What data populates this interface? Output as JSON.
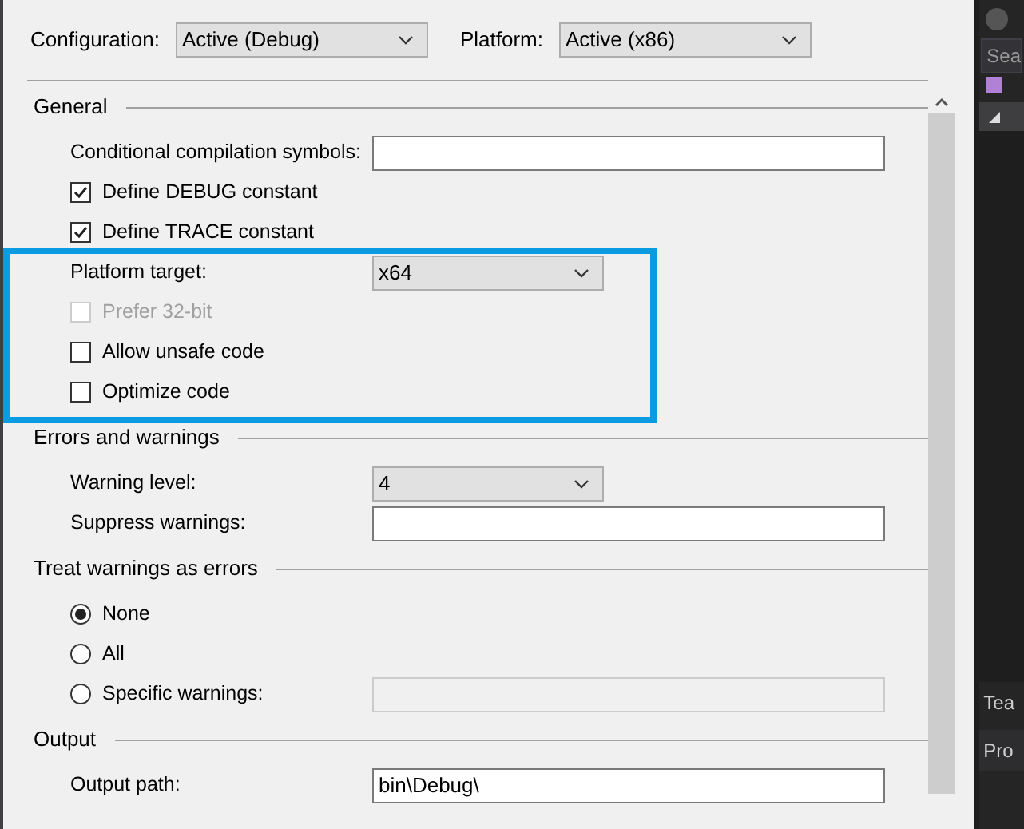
{
  "toolbar": [
    {
      "label": "Configuration:",
      "value": "Active (Debug)"
    },
    {
      "label": "Platform:",
      "value": "Active (x86)"
    }
  ],
  "sections": [
    {
      "title": "General",
      "rows": [
        {
          "kind": "text",
          "label": "Conditional compilation symbols:"
        },
        {
          "kind": "checkbox",
          "label": "Define DEBUG constant",
          "checked": true,
          "disabled": false
        },
        {
          "kind": "checkbox",
          "label": "Define TRACE constant",
          "checked": true,
          "disabled": false
        },
        {
          "kind": "dropdown",
          "label": "Platform target:",
          "value": "x64"
        },
        {
          "kind": "checkbox",
          "label": "Prefer 32-bit",
          "checked": false,
          "disabled": true
        },
        {
          "kind": "checkbox",
          "label": "Allow unsafe code",
          "checked": false,
          "disabled": false
        },
        {
          "kind": "checkbox",
          "label": "Optimize code",
          "checked": false,
          "disabled": false
        }
      ]
    },
    {
      "title": "Errors and warnings",
      "rows": [
        {
          "kind": "dropdown",
          "label": "Warning level:",
          "value": "4"
        },
        {
          "kind": "text",
          "label": "Suppress warnings:"
        }
      ]
    },
    {
      "title": "Treat warnings as errors",
      "rows": [
        {
          "kind": "radio",
          "label": "None",
          "selected": true
        },
        {
          "kind": "radio",
          "label": "All",
          "selected": false
        },
        {
          "kind": "radio_field",
          "label": "Specific warnings:",
          "selected": false,
          "field_disabled": true
        }
      ]
    },
    {
      "title": "Output",
      "rows": [
        {
          "kind": "path",
          "label": "Output path:",
          "value": "bin\\Debug\\"
        }
      ]
    }
  ],
  "right_panel": {
    "search_placeholder": "Sea",
    "items": [
      {
        "label": "Tea"
      },
      {
        "label": "Pro"
      }
    ]
  }
}
